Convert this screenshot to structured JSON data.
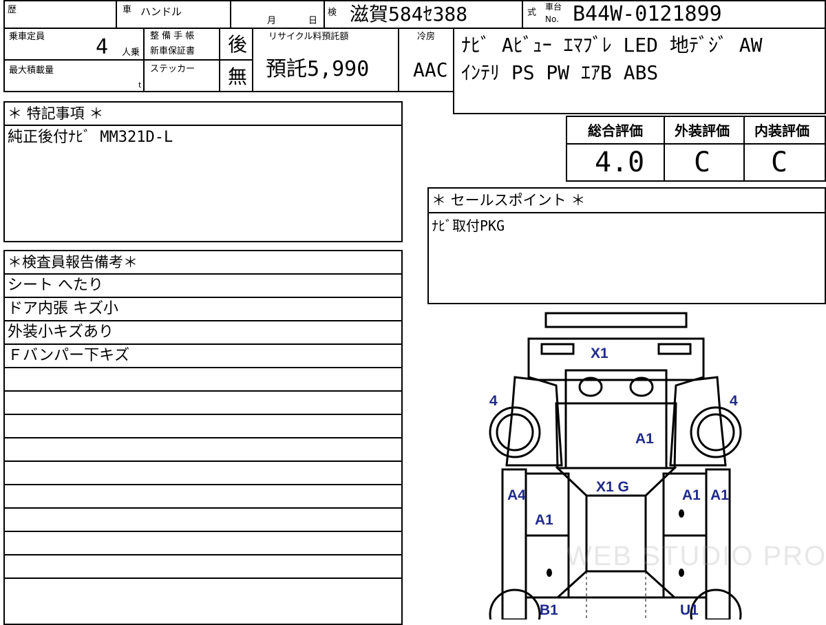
{
  "header": {
    "history_label": "歴",
    "car_label": "車",
    "handle_label": "ハンドル",
    "month_label": "月",
    "day_label": "日",
    "inspection_label": "検",
    "inspection_value": "滋賀584ｾ388",
    "type_label": "式",
    "chassis_label_top": "車台",
    "chassis_label_bottom": "No.",
    "chassis_value": "B44W-0121899"
  },
  "capacity": {
    "label": "乗車定員",
    "value": "4",
    "unit": "人乗"
  },
  "max_load": {
    "label": "最大積載量",
    "unit": "t"
  },
  "maintenance": {
    "label1": "整 備 手 帳",
    "label2": "新車保証書",
    "value": "後",
    "sticker_label": "ステッカー",
    "sticker_value": "無"
  },
  "recycle": {
    "label": "リサイクル料預託額",
    "value": "預託5,990"
  },
  "aircon": {
    "label": "冷房",
    "value": "AAC"
  },
  "equipment": {
    "line1": "ﾅﾋﾞ Aﾋﾞｭｰ ｴﾏﾌﾞﾚ LED 地ﾃﾞｼﾞ AW",
    "line2": "ｲﾝﾃﾘ PS PW ｴｱB ABS"
  },
  "special_notes": {
    "title": "＊ 特記事項 ＊",
    "text": "純正後付ﾅﾋﾞ MM321D-L"
  },
  "ratings": {
    "overall_label": "総合評価",
    "overall_value": "4.0",
    "exterior_label": "外装評価",
    "exterior_value": "C",
    "interior_label": "内装評価",
    "interior_value": "C"
  },
  "sales_point": {
    "title": "＊ セールスポイント ＊",
    "text": "ﾅﾋﾞ取付PKG"
  },
  "inspector_report": {
    "title": "＊検査員報告備考＊",
    "lines": [
      "シート へたり",
      "ドア内張 キズ小",
      "外装小キズあり",
      "Ｆバンパー下キズ",
      "",
      "",
      "",
      "",
      "",
      "",
      "",
      "",
      ""
    ]
  },
  "damage_map": {
    "roof": "X1",
    "front_left": "4",
    "front_right": "4",
    "hood_right": "A1",
    "windshield": "X1 G",
    "left_front_door": "A4",
    "left_pillar": "A1",
    "right_front_a": "A1",
    "right_front_b": "A1",
    "rear_left": "B1",
    "rear_right": "U1"
  },
  "watermark": "WEB STUDIO PRO"
}
